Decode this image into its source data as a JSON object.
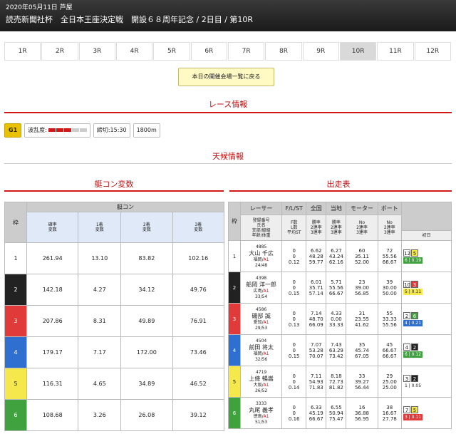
{
  "header": {
    "date_place": "2020年05月11日 芦屋",
    "title": "読売新聞社杯　全日本王座決定戦　開設６８周年記念 / 2日目 / 第10R"
  },
  "tabs": [
    "1R",
    "2R",
    "3R",
    "4R",
    "5R",
    "6R",
    "7R",
    "8R",
    "9R",
    "10R",
    "11R",
    "12R"
  ],
  "active_tab": "10R",
  "back_button": "本日の開催会場一覧に戻る",
  "sections": {
    "race_info": "レース情報",
    "weather": "天候情報",
    "boat_con": "艇コン変数",
    "entry": "出走表"
  },
  "race_info": {
    "grade": "G1",
    "wave_label": "波乱度:",
    "deadline": "締切:15:30",
    "distance": "1800m",
    "wave_level": 3,
    "wave_total": 5,
    "colors": {
      "wave_on": "#d01818",
      "wave_off": "#cccccc"
    }
  },
  "boat_con": {
    "group_header": "艇コン",
    "waku_header": "枠",
    "columns": [
      "確率\n変数",
      "1着\n変数",
      "2着\n変数",
      "3着\n変数"
    ],
    "rows": [
      {
        "waku": "1",
        "v": [
          "261.94",
          "13.10",
          "83.82",
          "102.16"
        ]
      },
      {
        "waku": "2",
        "v": [
          "142.18",
          "4.27",
          "34.12",
          "49.76"
        ]
      },
      {
        "waku": "3",
        "v": [
          "207.86",
          "8.31",
          "49.89",
          "76.91"
        ]
      },
      {
        "waku": "4",
        "v": [
          "179.17",
          "7.17",
          "172.00",
          "73.46"
        ]
      },
      {
        "waku": "5",
        "v": [
          "116.31",
          "4.65",
          "34.89",
          "46.52"
        ]
      },
      {
        "waku": "6",
        "v": [
          "108.68",
          "3.26",
          "26.08",
          "39.12"
        ]
      }
    ]
  },
  "entry": {
    "headers": [
      "枠",
      "レーサー",
      "F/L/ST",
      "全国",
      "当地",
      "モーター",
      "ボート"
    ],
    "subheaders": [
      "登録番号\n氏名\n支部/級級\n年齢/体重",
      "F数\nL数\n平均ST",
      "勝率\n2連率\n3連率",
      "勝率\n2連率\n3連率",
      "No\n2連率\n3連率",
      "No\n2連率\n3連率"
    ],
    "result_header": "初日",
    "rows": [
      {
        "waku": "1",
        "reg": "4885",
        "name": "大山 千広",
        "branch": "福岡/",
        "cls": "A1",
        "age": "24/48",
        "fl": [
          "0",
          "0",
          "0.12"
        ],
        "nat": [
          "6.62",
          "48.28",
          "59.77"
        ],
        "loc": [
          "6.27",
          "43.24",
          "62.16"
        ],
        "motor": [
          "60",
          "35.11",
          "52.00"
        ],
        "boat": [
          "72",
          "55.56",
          "66.67"
        ],
        "res": {
          "a": "12",
          "b": "5",
          "c": "6 | 0.19"
        }
      },
      {
        "waku": "2",
        "reg": "4398",
        "name": "船岡 洋一郎",
        "branch": "広島/",
        "cls": "A1",
        "age": "33/54",
        "fl": [
          "0",
          "0",
          "0.15"
        ],
        "nat": [
          "6.01",
          "35.71",
          "57.14"
        ],
        "loc": [
          "5.71",
          "55.56",
          "66.67"
        ],
        "motor": [
          "23",
          "39.00",
          "56.85"
        ],
        "boat": [
          "39",
          "30.00",
          "50.00"
        ],
        "res": {
          "a": "10",
          "b": "3",
          "c": "5 | 0.11"
        }
      },
      {
        "waku": "3",
        "reg": "4586",
        "name": "磯部 誠",
        "branch": "愛知/",
        "cls": "A1",
        "age": "29/53",
        "fl": [
          "0",
          "0",
          "0.13"
        ],
        "nat": [
          "7.14",
          "48.70",
          "66.09"
        ],
        "loc": [
          "4.33",
          "0.00",
          "33.33"
        ],
        "motor": [
          "31",
          "23.55",
          "41.62"
        ],
        "boat": [
          "55",
          "33.33",
          "55.56"
        ],
        "res": {
          "a": "2",
          "b": "6",
          "c": "4 | 0.21"
        }
      },
      {
        "waku": "4",
        "reg": "4504",
        "name": "前田 将太",
        "branch": "福岡/",
        "cls": "A1",
        "age": "32/56",
        "fl": [
          "0",
          "0",
          "0.15"
        ],
        "nat": [
          "7.07",
          "53.28",
          "70.07"
        ],
        "loc": [
          "7.43",
          "63.29",
          "73.42"
        ],
        "motor": [
          "35",
          "45.74",
          "67.05"
        ],
        "boat": [
          "45",
          "66.67",
          "66.67"
        ],
        "res": {
          "a": "4",
          "b": "2",
          "c": "6 | 0.12"
        }
      },
      {
        "waku": "5",
        "reg": "4719",
        "name": "上條 暢嵩",
        "branch": "大阪/",
        "cls": "A1",
        "age": "26/52",
        "fl": [
          "0",
          "0",
          "0.14"
        ],
        "nat": [
          "7.11",
          "54.93",
          "71.83"
        ],
        "loc": [
          "8.18",
          "72.73",
          "81.82"
        ],
        "motor": [
          "33",
          "39.27",
          "56.44"
        ],
        "boat": [
          "29",
          "25.00",
          "25.00"
        ],
        "res": {
          "a": "3",
          "b": "2",
          "c": "1 | 0.05"
        }
      },
      {
        "waku": "6",
        "reg": "3333",
        "name": "丸尾 義孝",
        "branch": "徳島/",
        "cls": "A1",
        "age": "51/53",
        "fl": [
          "0",
          "0",
          "0.16"
        ],
        "nat": [
          "6.33",
          "45.19",
          "66.67"
        ],
        "loc": [
          "6.55",
          "50.94",
          "75.47"
        ],
        "motor": [
          "16",
          "36.88",
          "56.95"
        ],
        "boat": [
          "38",
          "16.67",
          "27.78"
        ],
        "res": {
          "a": "7",
          "b": "5",
          "c": "3 | 0.11"
        }
      }
    ]
  }
}
